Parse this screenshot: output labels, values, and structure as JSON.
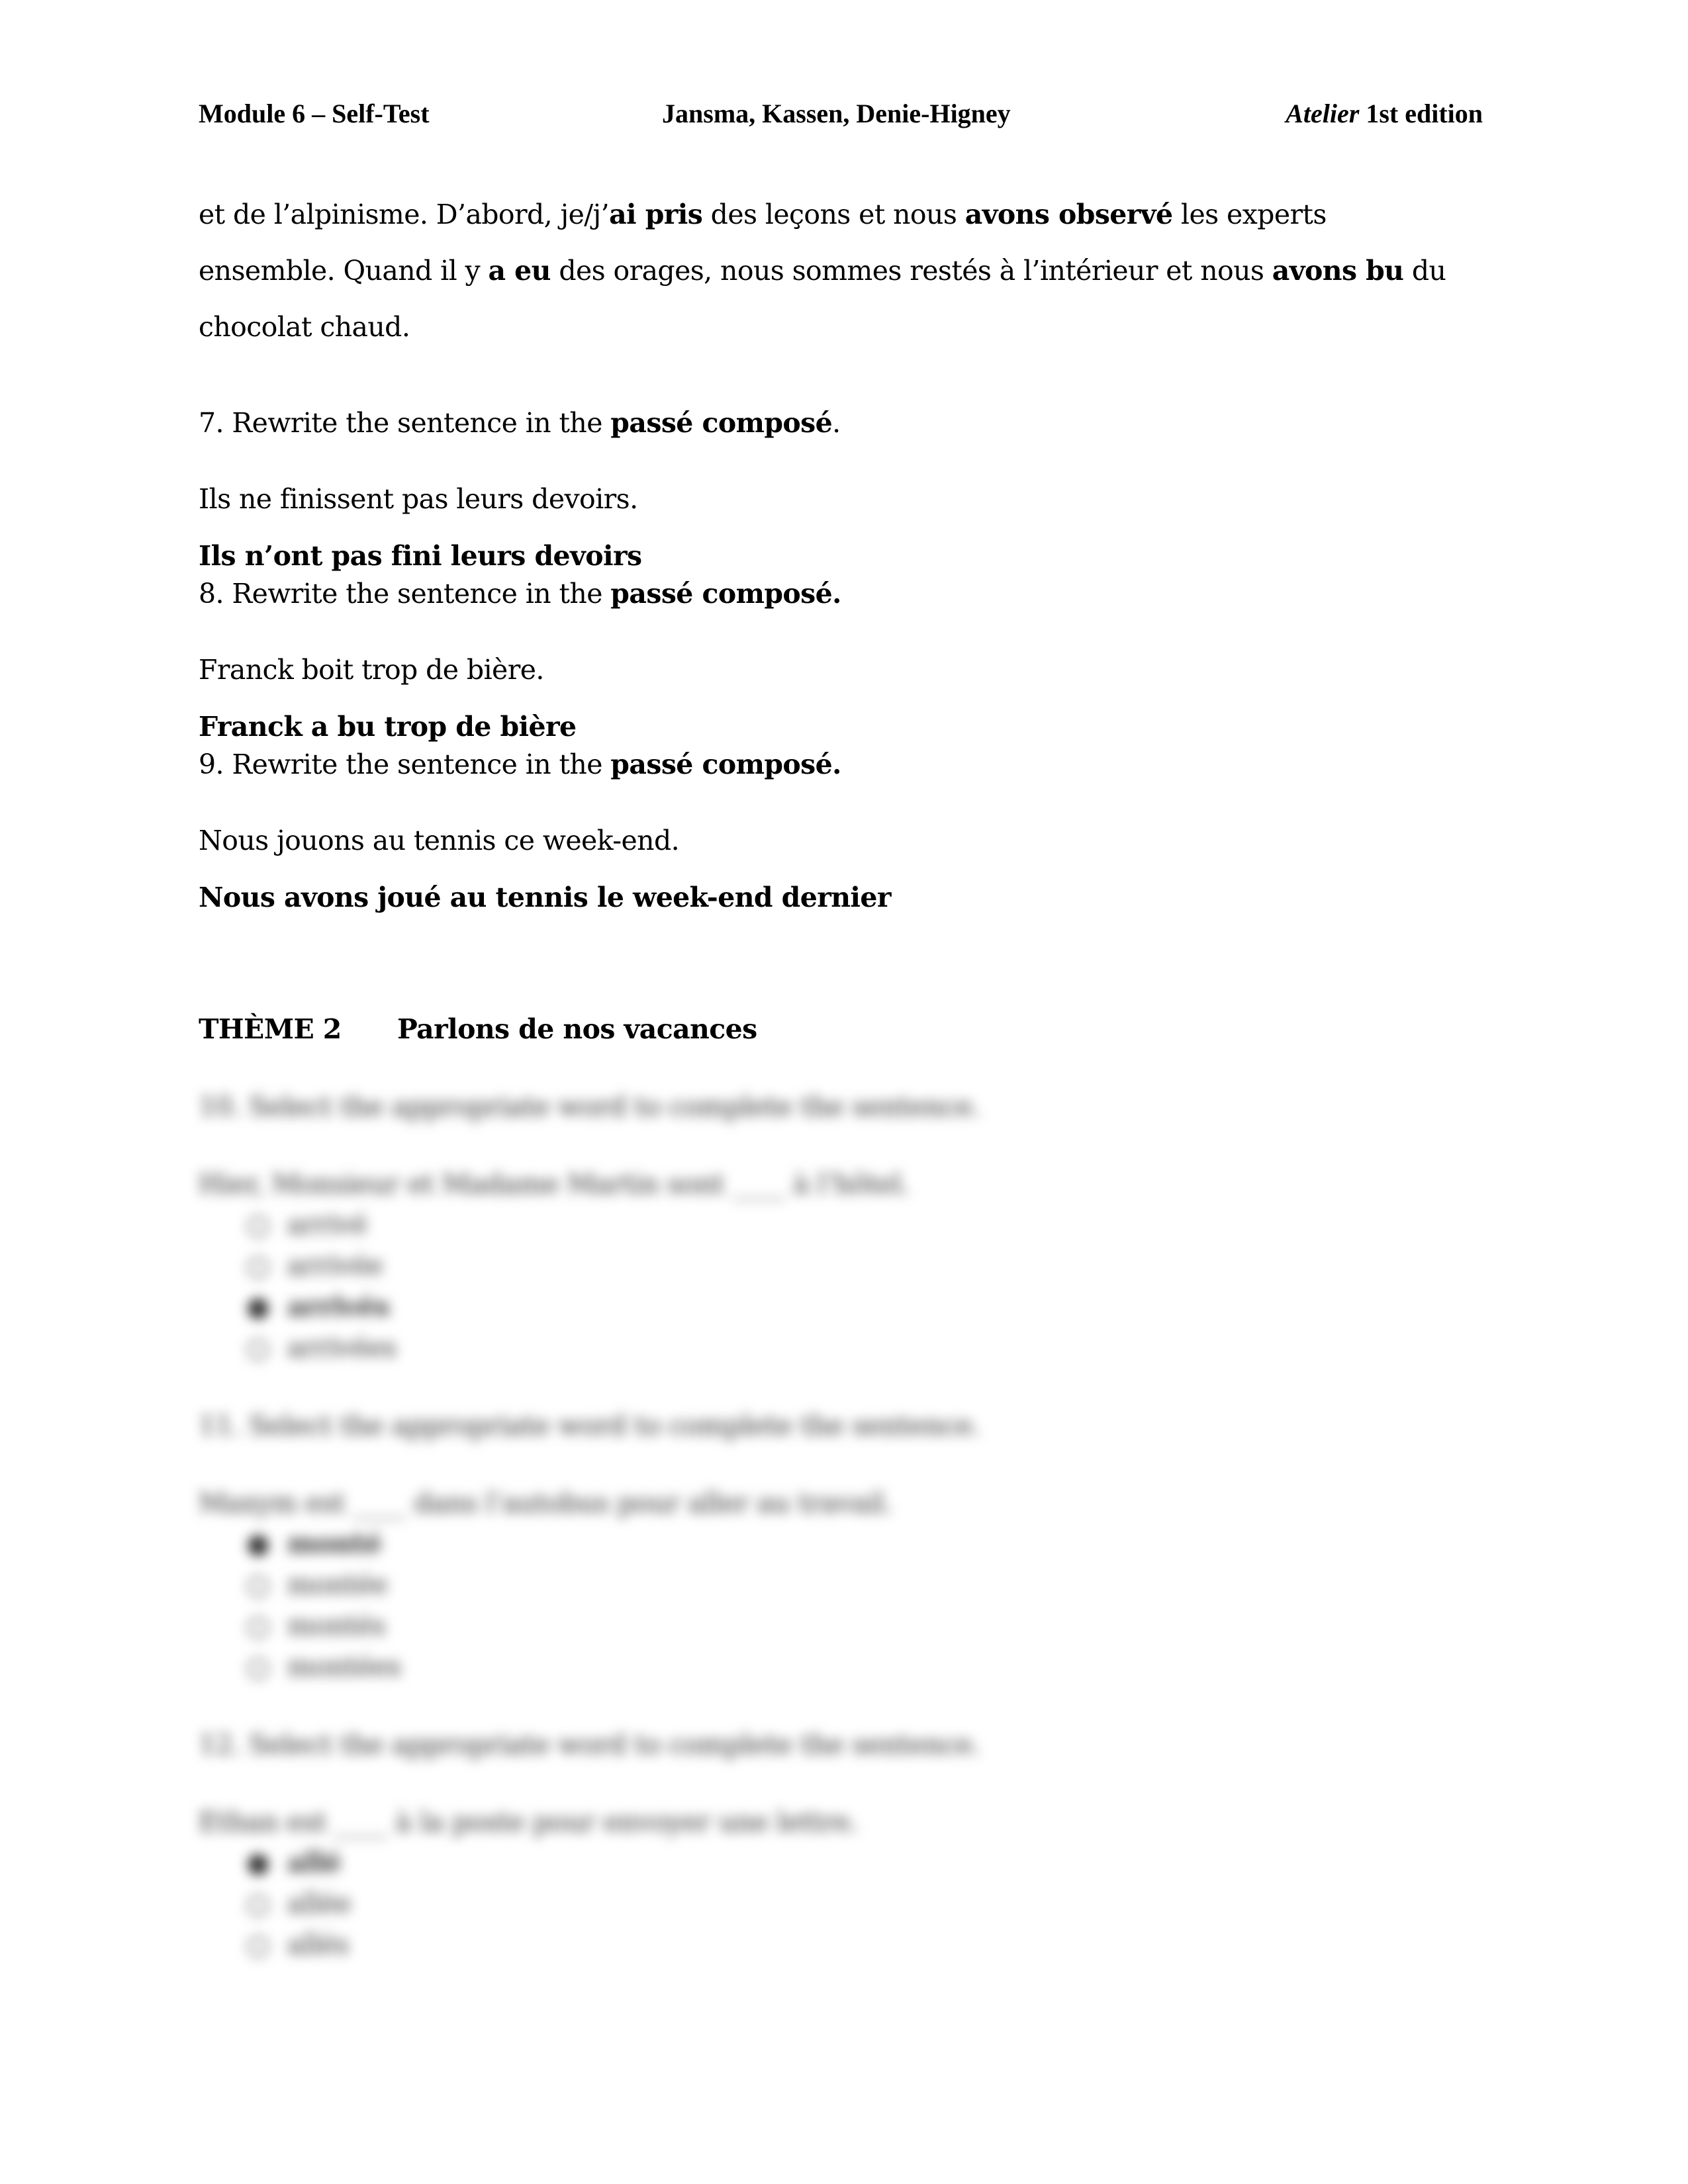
{
  "header": {
    "left": "Module 6 – Self-Test",
    "center": "Jansma, Kassen, Denie-Higney",
    "right_italic": "Atelier",
    "right_rest": " 1st edition"
  },
  "passage": {
    "line1": {
      "a": "et de l’alpinisme. D’abord, je/j’",
      "b1": "ai pris",
      "c": " des leçons et nous ",
      "b2": "avons observé",
      "d": " les experts"
    },
    "line2": {
      "a": "ensemble. Quand il y ",
      "b1": "a eu",
      "c": " des orages, nous sommes restés à l’intérieur et nous ",
      "b2": "avons bu",
      "d": " du"
    },
    "line3": "chocolat chaud."
  },
  "questions": [
    {
      "prompt": "7. Rewrite the sentence in the ",
      "prompt_bold": "passé composé",
      "prompt_tail": ".",
      "sentence": "Ils ne finissent pas leurs devoirs.",
      "answer": "Ils n’ont pas fini leurs devoirs"
    },
    {
      "prompt": "8. Rewrite the sentence in the ",
      "prompt_bold": "passé composé.",
      "prompt_tail": "",
      "sentence": "Franck boit trop de bière.",
      "answer": "Franck a bu trop de bière"
    },
    {
      "prompt": "9. Rewrite the sentence in the ",
      "prompt_bold": "passé composé.",
      "prompt_tail": "",
      "sentence": "Nous jouons au tennis ce week-end.",
      "answer": "Nous avons joué au tennis le week-end dernier"
    }
  ],
  "theme": {
    "number": "THÈME 2",
    "title": "Parlons de nos vacances"
  },
  "blurred_questions": [
    {
      "prompt": "10. Select the appropriate word to complete the sentence.",
      "sentence": "Hier, Monsieur et Madame Martin sont ____ à l’hôtel.",
      "options": [
        "arrivé",
        "arrivée",
        "arrivés",
        "arrivées"
      ],
      "selected_index": 2
    },
    {
      "prompt": "11. Select the appropriate word to complete the sentence.",
      "sentence": "Maxym est ____ dans l’autobus pour aller au travail.",
      "options": [
        "monté",
        "montée",
        "montés",
        "montées"
      ],
      "selected_index": 0
    },
    {
      "prompt": "12. Select the appropriate word to complete the sentence.",
      "sentence": "Ethan est ____ à la poste pour envoyer une lettre.",
      "options": [
        "allé",
        "allée",
        "allés"
      ],
      "selected_index": 0
    }
  ],
  "icons": {
    "radio_empty": "○",
    "radio_selected": "●"
  }
}
